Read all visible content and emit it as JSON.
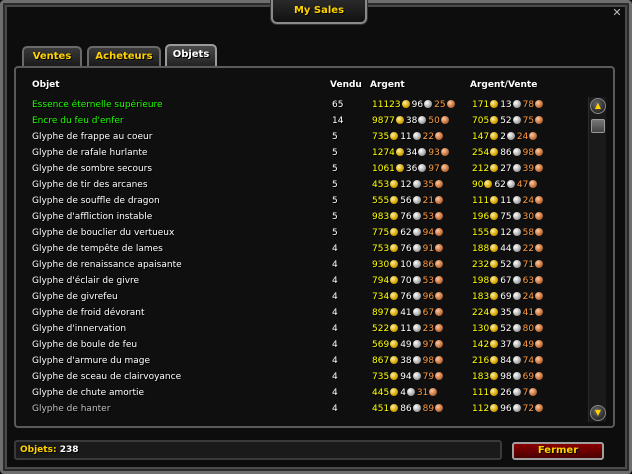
{
  "window": {
    "title": "My Sales"
  },
  "tabs": [
    {
      "label": "Ventes"
    },
    {
      "label": "Acheteurs"
    },
    {
      "label": "Objets"
    }
  ],
  "table": {
    "headers": {
      "item": "Objet",
      "sold": "Vendu",
      "money": "Argent",
      "per": "Argent/Vente"
    },
    "rows": [
      {
        "name": "Essence éternelle supérieure",
        "quality": "green",
        "sold": "65",
        "money": [
          "11123",
          "96",
          "25"
        ],
        "per": [
          "171",
          "13",
          "78"
        ]
      },
      {
        "name": "Encre du feu d'enfer",
        "quality": "green",
        "sold": "14",
        "money": [
          "9877",
          "38",
          "50"
        ],
        "per": [
          "705",
          "52",
          "75"
        ]
      },
      {
        "name": "Glyphe de frappe au coeur",
        "quality": "white",
        "sold": "5",
        "money": [
          "735",
          "11",
          "22"
        ],
        "per": [
          "147",
          "2",
          "24"
        ]
      },
      {
        "name": "Glyphe de rafale hurlante",
        "quality": "white",
        "sold": "5",
        "money": [
          "1274",
          "34",
          "93"
        ],
        "per": [
          "254",
          "86",
          "98"
        ]
      },
      {
        "name": "Glyphe de sombre secours",
        "quality": "white",
        "sold": "5",
        "money": [
          "1061",
          "36",
          "97"
        ],
        "per": [
          "212",
          "27",
          "39"
        ]
      },
      {
        "name": "Glyphe de tir des arcanes",
        "quality": "white",
        "sold": "5",
        "money": [
          "453",
          "12",
          "35"
        ],
        "per": [
          "90",
          "62",
          "47"
        ]
      },
      {
        "name": "Glyphe de souffle de dragon",
        "quality": "white",
        "sold": "5",
        "money": [
          "555",
          "56",
          "21"
        ],
        "per": [
          "111",
          "11",
          "24"
        ]
      },
      {
        "name": "Glyphe d'affliction instable",
        "quality": "white",
        "sold": "5",
        "money": [
          "983",
          "76",
          "53"
        ],
        "per": [
          "196",
          "75",
          "30"
        ]
      },
      {
        "name": "Glyphe de bouclier du vertueux",
        "quality": "white",
        "sold": "5",
        "money": [
          "775",
          "62",
          "94"
        ],
        "per": [
          "155",
          "12",
          "58"
        ]
      },
      {
        "name": "Glyphe de tempête de lames",
        "quality": "white",
        "sold": "4",
        "money": [
          "753",
          "76",
          "91"
        ],
        "per": [
          "188",
          "44",
          "22"
        ]
      },
      {
        "name": "Glyphe de renaissance apaisante",
        "quality": "white",
        "sold": "4",
        "money": [
          "930",
          "10",
          "86"
        ],
        "per": [
          "232",
          "52",
          "71"
        ]
      },
      {
        "name": "Glyphe d'éclair de givre",
        "quality": "white",
        "sold": "4",
        "money": [
          "794",
          "70",
          "53"
        ],
        "per": [
          "198",
          "67",
          "63"
        ]
      },
      {
        "name": "Glyphe de givrefeu",
        "quality": "white",
        "sold": "4",
        "money": [
          "734",
          "76",
          "96"
        ],
        "per": [
          "183",
          "69",
          "24"
        ]
      },
      {
        "name": "Glyphe de froid dévorant",
        "quality": "white",
        "sold": "4",
        "money": [
          "897",
          "41",
          "67"
        ],
        "per": [
          "224",
          "35",
          "41"
        ]
      },
      {
        "name": "Glyphe d'innervation",
        "quality": "white",
        "sold": "4",
        "money": [
          "522",
          "11",
          "23"
        ],
        "per": [
          "130",
          "52",
          "80"
        ]
      },
      {
        "name": "Glyphe de boule de feu",
        "quality": "white",
        "sold": "4",
        "money": [
          "569",
          "49",
          "97"
        ],
        "per": [
          "142",
          "37",
          "49"
        ]
      },
      {
        "name": "Glyphe d'armure du mage",
        "quality": "white",
        "sold": "4",
        "money": [
          "867",
          "38",
          "98"
        ],
        "per": [
          "216",
          "84",
          "74"
        ]
      },
      {
        "name": "Glyphe de sceau de clairvoyance",
        "quality": "white",
        "sold": "4",
        "money": [
          "735",
          "94",
          "79"
        ],
        "per": [
          "183",
          "98",
          "69"
        ]
      },
      {
        "name": "Glyphe de chute amortie",
        "quality": "white",
        "sold": "4",
        "money": [
          "445",
          "4",
          "31"
        ],
        "per": [
          "111",
          "26",
          "7"
        ]
      },
      {
        "name": "Glyphe de hanter",
        "quality": "faded",
        "sold": "4",
        "money": [
          "451",
          "86",
          "89"
        ],
        "per": [
          "112",
          "96",
          "72"
        ]
      }
    ]
  },
  "footer": {
    "items_label": "Objets:",
    "items_count": "238",
    "close_label": "Fermer"
  },
  "colors": {
    "gold_text": "#ffd200",
    "uncommon": "#1eff00",
    "copper": "#ff9a3c"
  },
  "icons": {
    "close": "close-icon",
    "scroll_up": "arrow-up-icon",
    "scroll_down": "arrow-down-icon"
  }
}
